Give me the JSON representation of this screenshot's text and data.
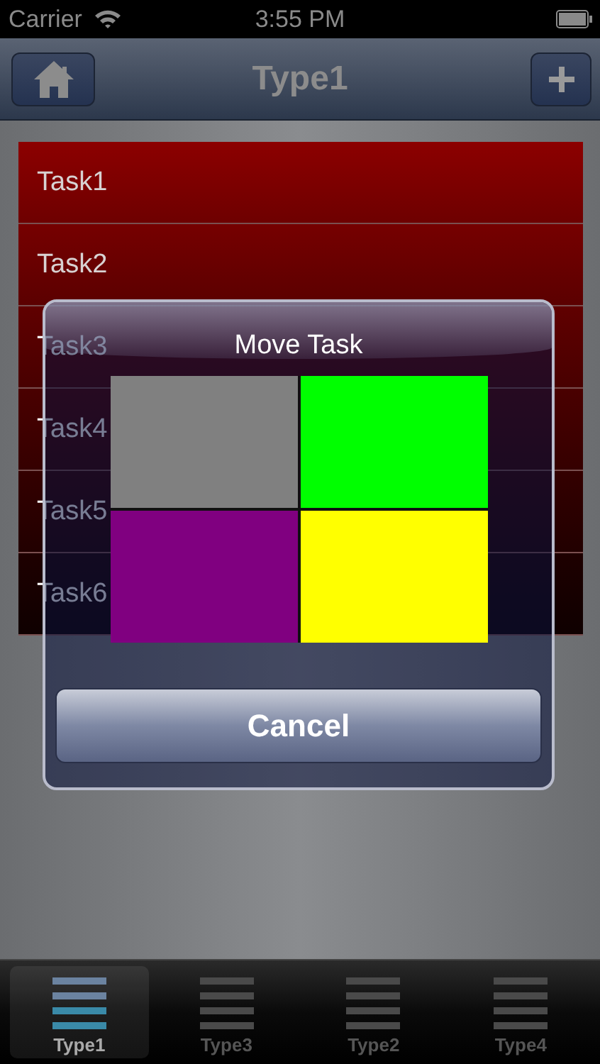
{
  "status_bar": {
    "carrier": "Carrier",
    "time": "3:55 PM"
  },
  "nav_bar": {
    "title": "Type1"
  },
  "tasks": [
    {
      "label": "Task1"
    },
    {
      "label": "Task2"
    },
    {
      "label": "Task3"
    },
    {
      "label": "Task4"
    },
    {
      "label": "Task5"
    },
    {
      "label": "Task6"
    }
  ],
  "dialog": {
    "title": "Move Task",
    "swatches": [
      {
        "color": "#808080"
      },
      {
        "color": "#00ff00"
      },
      {
        "color": "#800080"
      },
      {
        "color": "#ffff00"
      }
    ],
    "cancel": "Cancel"
  },
  "tabs": [
    {
      "label": "Type1",
      "selected": true
    },
    {
      "label": "Type3",
      "selected": false
    },
    {
      "label": "Type2",
      "selected": false
    },
    {
      "label": "Type4",
      "selected": false
    }
  ]
}
